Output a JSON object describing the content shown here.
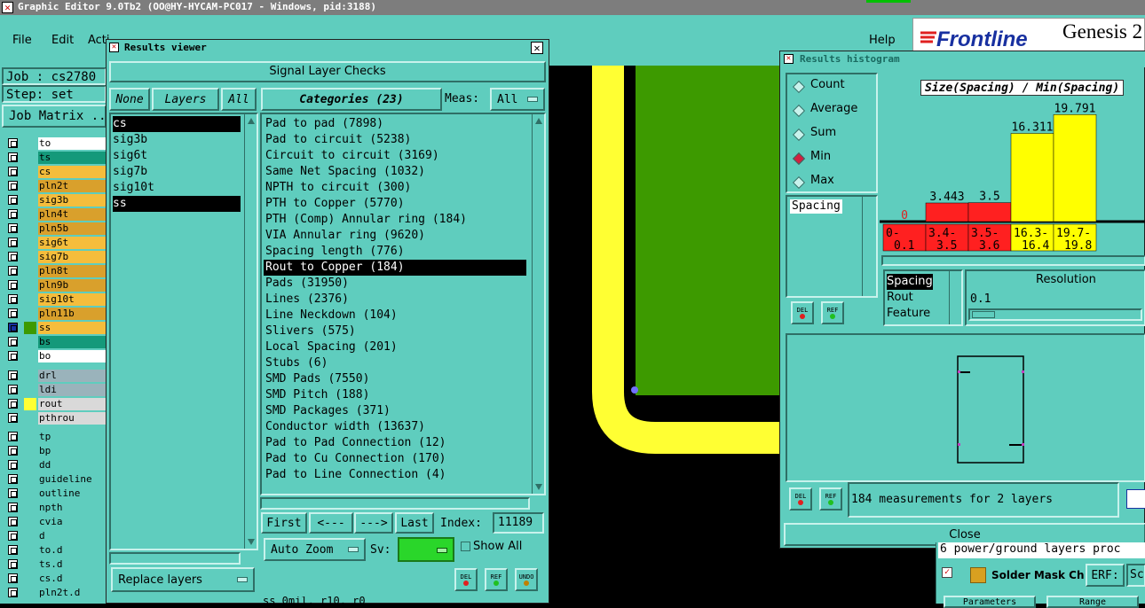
{
  "window_title": "Graphic Editor 9.0Tb2 (OO@HY-HYCAM-PC017 - Windows, pid:3188)",
  "menu": {
    "file": "File",
    "edit": "Edit",
    "actions": "Acti",
    "help": "Help"
  },
  "brand": {
    "logo": "Frontline",
    "product": "Genesis 2"
  },
  "job": {
    "job_label": "Job : cs2780",
    "step_label": "Step: set",
    "matrix_button": "Job Matrix ..."
  },
  "layers": {
    "group1": [
      {
        "name": "to",
        "color": "#ffffff"
      },
      {
        "name": "ts",
        "color": "#14997a"
      },
      {
        "name": "cs",
        "color": "#f5bd3c"
      },
      {
        "name": "pln2t",
        "color": "#d9a02c"
      },
      {
        "name": "sig3b",
        "color": "#f5bd3c"
      },
      {
        "name": "pln4t",
        "color": "#d9a02c"
      },
      {
        "name": "pln5b",
        "color": "#d9a02c"
      },
      {
        "name": "sig6t",
        "color": "#f5bd3c"
      },
      {
        "name": "sig7b",
        "color": "#f5bd3c"
      },
      {
        "name": "pln8t",
        "color": "#d9a02c"
      },
      {
        "name": "pln9b",
        "color": "#d9a02c"
      },
      {
        "name": "sig10t",
        "color": "#f5bd3c"
      },
      {
        "name": "pln11b",
        "color": "#d9a02c"
      },
      {
        "name": "ss",
        "color": "#f5bd3c"
      },
      {
        "name": "bs",
        "color": "#14997a"
      },
      {
        "name": "bo",
        "color": "#ffffff"
      }
    ],
    "group2": [
      {
        "name": "drl",
        "color": "#9ab3bb"
      },
      {
        "name": "ldi",
        "color": "#9ab3bb"
      },
      {
        "name": "rout",
        "color": "#d9d9d9"
      },
      {
        "name": "pthrou",
        "color": "#d9d9d9"
      }
    ],
    "group3": [
      {
        "name": "tp",
        "color": "#5fcdbe"
      },
      {
        "name": "bp",
        "color": "#5fcdbe"
      },
      {
        "name": "dd",
        "color": "#5fcdbe"
      },
      {
        "name": "guideline",
        "color": "#5fcdbe"
      },
      {
        "name": "outline",
        "color": "#5fcdbe"
      },
      {
        "name": "npth",
        "color": "#5fcdbe"
      },
      {
        "name": "cvia",
        "color": "#5fcdbe"
      },
      {
        "name": "d",
        "color": "#5fcdbe"
      },
      {
        "name": "to.d",
        "color": "#5fcdbe"
      },
      {
        "name": "ts.d",
        "color": "#5fcdbe"
      },
      {
        "name": "cs.d",
        "color": "#5fcdbe"
      },
      {
        "name": "pln2t.d",
        "color": "#5fcdbe"
      }
    ]
  },
  "results_viewer": {
    "title": "Results viewer",
    "header": "Signal Layer Checks",
    "none_btn": "None",
    "layers_btn": "Layers",
    "all_btn": "All",
    "layer_list": [
      "cs",
      "sig3b",
      "sig6t",
      "sig7b",
      "sig10t",
      "ss"
    ],
    "categories_btn": "Categories (23)",
    "meas_label": "Meas:",
    "meas_value": "All",
    "categories": [
      "Pad to pad (7898)",
      "Pad to circuit (5238)",
      "Circuit to circuit (3169)",
      "Same Net Spacing (1032)",
      "NPTH to circuit (300)",
      "PTH to Copper (5770)",
      "PTH (Comp) Annular ring (184)",
      "VIA Annular ring (9620)",
      "Spacing length (776)",
      "Rout to Copper (184)",
      "Pads (31950)",
      "Lines (2376)",
      "Line Neckdown (104)",
      "Slivers (575)",
      "Local Spacing (201)",
      "Stubs (6)",
      "SMD Pads (7550)",
      "SMD Pitch (188)",
      "SMD Packages (371)",
      "Conductor width (13637)",
      "Pad to Pad Connection (12)",
      "Pad to Cu Connection (170)",
      "Pad to Line Connection (4)"
    ],
    "first": "First",
    "prev": "<---",
    "next": "--->",
    "last": "Last",
    "index_label": "Index:",
    "index_value": "11189",
    "auto_zoom": "Auto Zoom",
    "sv_label": "Sv:",
    "show_all": "Show All",
    "replace_layers": "Replace layers",
    "del": "DEL",
    "ref": "REF",
    "undo": "UNDO",
    "status": "ss 0mil, r10, r0"
  },
  "histogram": {
    "title": "Results histogram",
    "stats": [
      "Count",
      "Average",
      "Sum",
      "Min",
      "Max"
    ],
    "selected_stat": "Min",
    "chart_title": "Size(Spacing) / Min(Spacing)",
    "measure_list": [
      "Spacing"
    ],
    "del": "DEL",
    "ref": "REF",
    "attr_list": [
      "Spacing",
      "Rout",
      "Feature"
    ],
    "resolution_label": "Resolution",
    "resolution_value": "0.1",
    "measurement_text": "184 measurements for 2 layers",
    "close": "Close"
  },
  "chart_data": {
    "type": "bar",
    "title": "Size(Spacing) / Min(Spacing)",
    "categories": [
      "0-0.1",
      "3.4-3.5",
      "3.5-3.6",
      "16.3-16.4",
      "19.7-19.8"
    ],
    "values": [
      0,
      3.443,
      3.5,
      16.311,
      19.791
    ],
    "labels": [
      "0",
      "3.443",
      "3.5",
      "16.311",
      "19.791"
    ],
    "colors": [
      "#ff2020",
      "#ff2020",
      "#ff2020",
      "#ffff00",
      "#ffff00"
    ],
    "ylim": [
      0,
      20
    ]
  },
  "bottom_panel": {
    "power_text": "6 power/ground layers proc",
    "solder_mask": "Solder Mask Ch",
    "erf_label": "ERF:",
    "erf_value": "Sc",
    "param_label": "Parameters",
    "range_label": "Range"
  },
  "colors": {
    "panel": "#5fcdbe",
    "accent": "#14997a",
    "board_green": "#3d9a00",
    "trace_yellow": "#ffff33"
  }
}
